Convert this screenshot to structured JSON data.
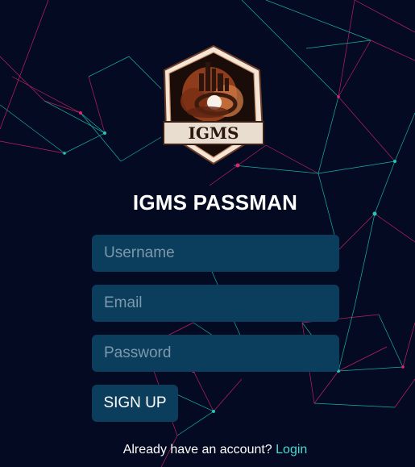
{
  "app": {
    "title": "IGMS PASSMAN"
  },
  "logo": {
    "text": "IGMS"
  },
  "form": {
    "username_placeholder": "Username",
    "email_placeholder": "Email",
    "password_placeholder": "Password",
    "submit_label": "SIGN UP"
  },
  "footer": {
    "prompt": "Already have an account?",
    "link_label": "Login"
  },
  "colors": {
    "background": "#030a22",
    "input_bg": "#0b3d5d",
    "link": "#4dd9d0",
    "line_pink": "#e0246e",
    "line_teal": "#1fc9b9"
  }
}
